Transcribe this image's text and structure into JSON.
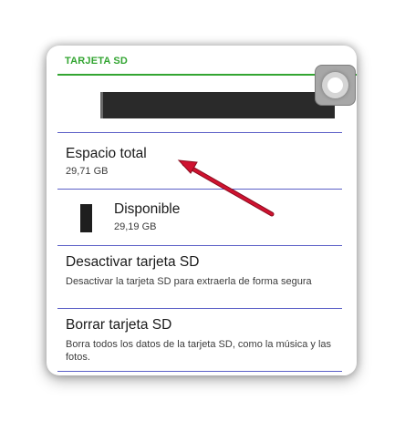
{
  "section": {
    "title": "TARJETA SD"
  },
  "rows": [
    {
      "title": "Espacio total",
      "subtitle": "29,71 GB"
    },
    {
      "title": "Disponible",
      "subtitle": "29,19 GB"
    },
    {
      "title": "Desactivar tarjeta SD",
      "subtitle": "Desactivar la tarjeta SD para extraerla de forma segura"
    },
    {
      "title": "Borrar tarjeta SD",
      "subtitle": "Borra todos los datos de la tarjeta SD, como la música y las fotos."
    }
  ],
  "colors": {
    "accent_green": "#33a532",
    "divider_blue": "#5b5fc7",
    "arrow_red": "#c8102e"
  },
  "icons": {
    "assistive_touch": "assistive-touch-icon",
    "annotation_arrow": "red-arrow-icon"
  }
}
